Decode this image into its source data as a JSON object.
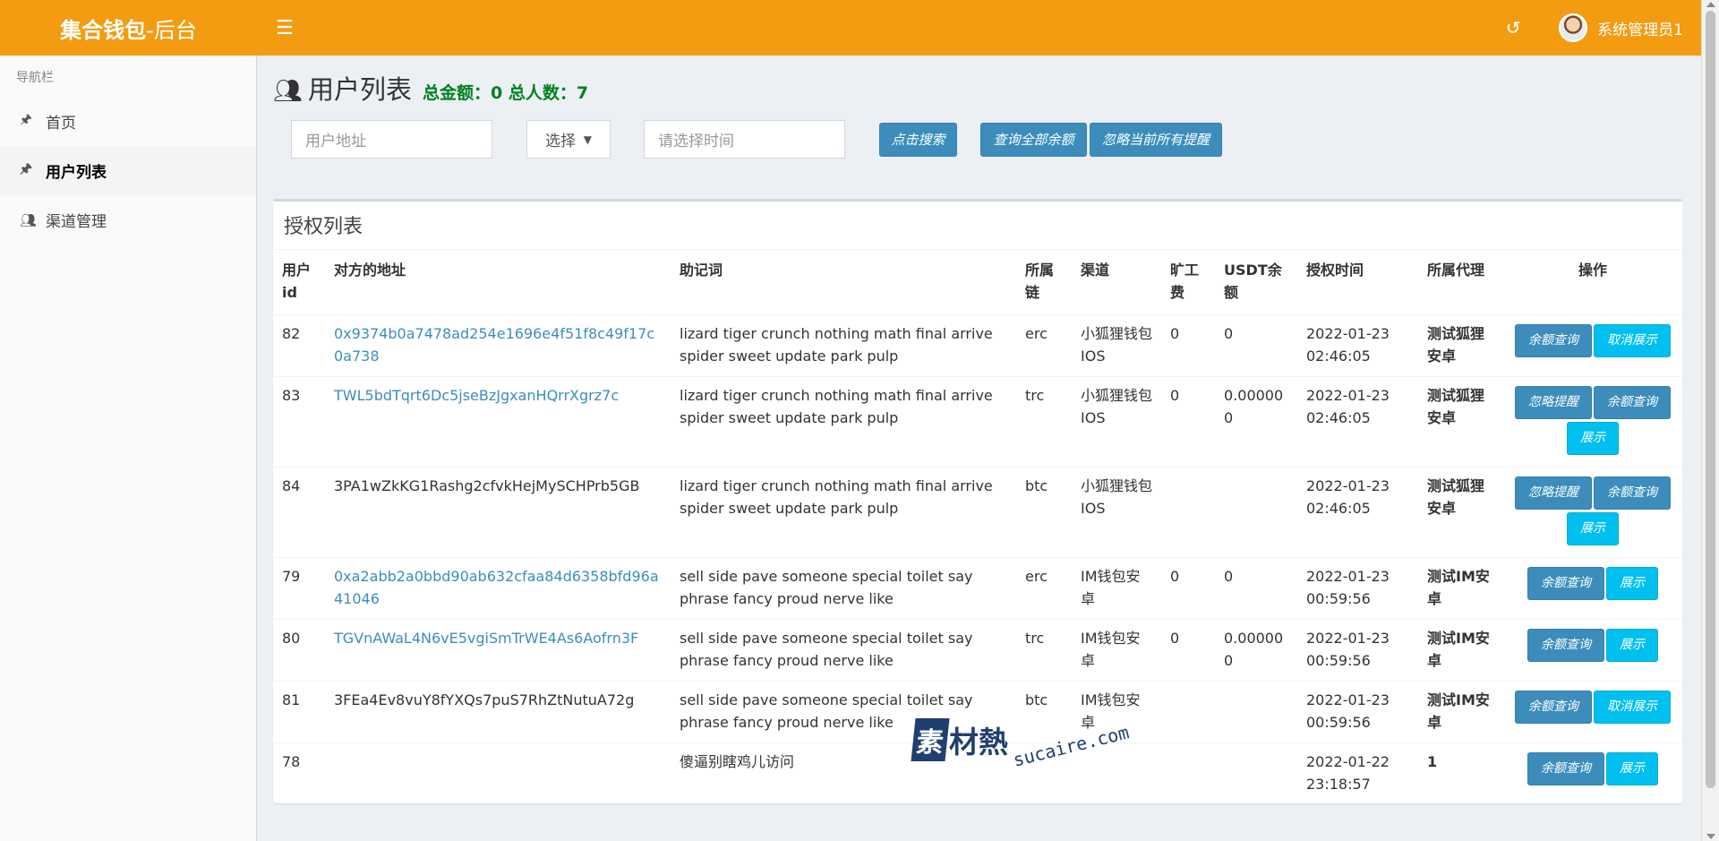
{
  "header": {
    "brand_bold": "集合钱包",
    "brand_light": "-后台",
    "menu_toggle_icon": "bars-icon",
    "history_icon": "history-icon",
    "user_name": "系统管理员1",
    "bg_color": "#f39c12"
  },
  "sidebar": {
    "title": "导航栏",
    "items": [
      {
        "label": "首页",
        "icon": "pin-icon",
        "active": false
      },
      {
        "label": "用户列表",
        "icon": "pin-icon",
        "active": true
      },
      {
        "label": "渠道管理",
        "icon": "users-icon",
        "active": false
      }
    ]
  },
  "page": {
    "title": "用户列表",
    "totals": "总金额：0 总人数：7"
  },
  "filters": {
    "address_placeholder": "用户地址",
    "select_value": "选择",
    "time_placeholder": "请选择时间",
    "search_button": "点击搜索",
    "query_all_button": "查询全部余额",
    "ignore_all_button": "忽略当前所有提醒"
  },
  "table": {
    "title": "授权列表",
    "columns": [
      "用户id",
      "对方的地址",
      "助记词",
      "所属链",
      "渠道",
      "旷工费",
      "USDT余额",
      "授权时间",
      "所属代理",
      "操作"
    ],
    "rows": [
      {
        "id": "82",
        "address": "0x9374b0a7478ad254e1696e4f51f8c49f17c0a738",
        "address_link": true,
        "mnemonic": "lizard tiger crunch nothing math final arrive spider sweet update park pulp",
        "chain": "erc",
        "channel": "小狐狸钱包IOS",
        "fee": "0",
        "usdt": "0",
        "time": "2022-01-23 02:46:05",
        "agent": "测试狐狸安卓",
        "actions": [
          {
            "label": "余额查询",
            "style": "primary"
          },
          {
            "label": "取消展示",
            "style": "info"
          }
        ]
      },
      {
        "id": "83",
        "address": "TWL5bdTqrt6Dc5jseBzJgxanHQrrXgrz7c",
        "address_link": true,
        "mnemonic": "lizard tiger crunch nothing math final arrive spider sweet update park pulp",
        "chain": "trc",
        "channel": "小狐狸钱包IOS",
        "fee": "0",
        "usdt": "0.000000",
        "time": "2022-01-23 02:46:05",
        "agent": "测试狐狸安卓",
        "actions": [
          {
            "label": "忽略提醒",
            "style": "primary"
          },
          {
            "label": "余额查询",
            "style": "primary"
          },
          {
            "label": "展示",
            "style": "info"
          }
        ]
      },
      {
        "id": "84",
        "address": "3PA1wZkKG1Rashg2cfvkHejMySCHPrb5GB",
        "address_link": false,
        "mnemonic": "lizard tiger crunch nothing math final arrive spider sweet update park pulp",
        "chain": "btc",
        "channel": "小狐狸钱包IOS",
        "fee": "",
        "usdt": "",
        "time": "2022-01-23 02:46:05",
        "agent": "测试狐狸安卓",
        "actions": [
          {
            "label": "忽略提醒",
            "style": "primary"
          },
          {
            "label": "余额查询",
            "style": "primary"
          },
          {
            "label": "展示",
            "style": "info"
          }
        ]
      },
      {
        "id": "79",
        "address": "0xa2abb2a0bbd90ab632cfaa84d6358bfd96a41046",
        "address_link": true,
        "mnemonic": "sell side pave someone special toilet say phrase fancy proud nerve like",
        "chain": "erc",
        "channel": "IM钱包安卓",
        "fee": "0",
        "usdt": "0",
        "time": "2022-01-23 00:59:56",
        "agent": "测试IM安卓",
        "actions": [
          {
            "label": "余额查询",
            "style": "primary"
          },
          {
            "label": "展示",
            "style": "info"
          }
        ]
      },
      {
        "id": "80",
        "address": "TGVnAWaL4N6vE5vgiSmTrWE4As6Aofrn3F",
        "address_link": true,
        "mnemonic": "sell side pave someone special toilet say phrase fancy proud nerve like",
        "chain": "trc",
        "channel": "IM钱包安卓",
        "fee": "0",
        "usdt": "0.000000",
        "time": "2022-01-23 00:59:56",
        "agent": "测试IM安卓",
        "actions": [
          {
            "label": "余额查询",
            "style": "primary"
          },
          {
            "label": "展示",
            "style": "info"
          }
        ]
      },
      {
        "id": "81",
        "address": "3FEa4Ev8vuY8fYXQs7puS7RhZtNutuA72g",
        "address_link": false,
        "mnemonic": "sell side pave someone special toilet say phrase fancy proud nerve like",
        "chain": "btc",
        "channel": "IM钱包安卓",
        "fee": "",
        "usdt": "",
        "time": "2022-01-23 00:59:56",
        "agent": "测试IM安卓",
        "actions": [
          {
            "label": "余额查询",
            "style": "primary"
          },
          {
            "label": "取消展示",
            "style": "info"
          }
        ]
      },
      {
        "id": "78",
        "address": "",
        "address_link": false,
        "mnemonic": "傻逼别瞎鸡儿访问",
        "chain": "",
        "channel": "",
        "fee": "",
        "usdt": "",
        "time": "2022-01-22 23:18:57",
        "agent": "1",
        "actions": [
          {
            "label": "余额查询",
            "style": "primary"
          },
          {
            "label": "展示",
            "style": "info"
          }
        ]
      }
    ]
  },
  "watermark": {
    "logo_char": "素",
    "text": "材熱",
    "domain": "sucaire.com"
  }
}
